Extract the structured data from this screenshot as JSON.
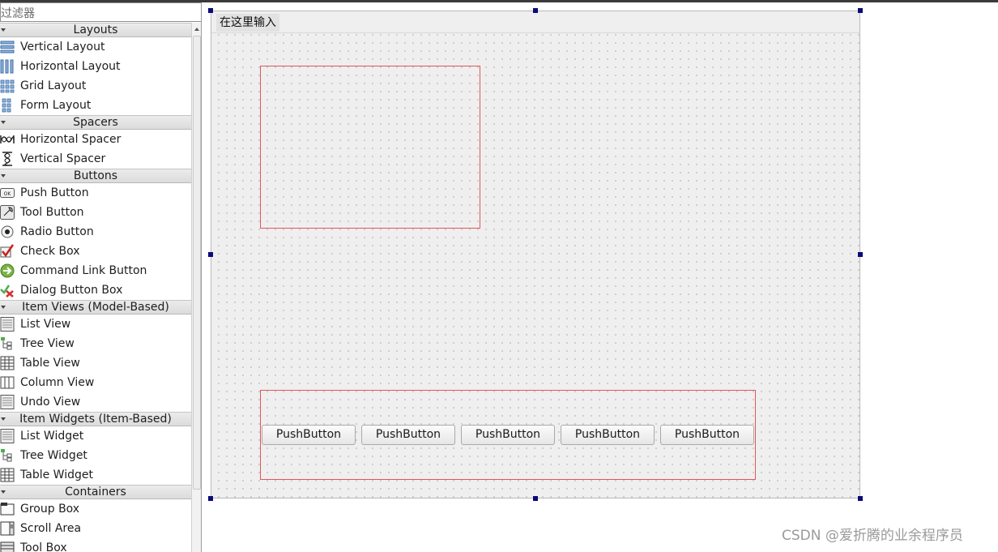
{
  "widget_box": {
    "filter_placeholder": "过滤器",
    "categories": [
      {
        "title": "Layouts",
        "items": [
          {
            "label": "Vertical Layout",
            "icon": "vertical-layout-icon"
          },
          {
            "label": "Horizontal Layout",
            "icon": "horizontal-layout-icon"
          },
          {
            "label": "Grid Layout",
            "icon": "grid-layout-icon"
          },
          {
            "label": "Form Layout",
            "icon": "form-layout-icon"
          }
        ]
      },
      {
        "title": "Spacers",
        "items": [
          {
            "label": "Horizontal Spacer",
            "icon": "horizontal-spacer-icon"
          },
          {
            "label": "Vertical Spacer",
            "icon": "vertical-spacer-icon"
          }
        ]
      },
      {
        "title": "Buttons",
        "items": [
          {
            "label": "Push Button",
            "icon": "push-button-icon"
          },
          {
            "label": "Tool Button",
            "icon": "tool-button-icon"
          },
          {
            "label": "Radio Button",
            "icon": "radio-button-icon"
          },
          {
            "label": "Check Box",
            "icon": "check-box-icon"
          },
          {
            "label": "Command Link Button",
            "icon": "command-link-icon"
          },
          {
            "label": "Dialog Button Box",
            "icon": "dialog-button-box-icon"
          }
        ]
      },
      {
        "title": "Item Views (Model-Based)",
        "items": [
          {
            "label": "List View",
            "icon": "list-view-icon"
          },
          {
            "label": "Tree View",
            "icon": "tree-view-icon"
          },
          {
            "label": "Table View",
            "icon": "table-view-icon"
          },
          {
            "label": "Column View",
            "icon": "column-view-icon"
          },
          {
            "label": "Undo View",
            "icon": "undo-view-icon"
          }
        ]
      },
      {
        "title": "Item Widgets (Item-Based)",
        "items": [
          {
            "label": "List Widget",
            "icon": "list-widget-icon"
          },
          {
            "label": "Tree Widget",
            "icon": "tree-widget-icon"
          },
          {
            "label": "Table Widget",
            "icon": "table-widget-icon"
          }
        ]
      },
      {
        "title": "Containers",
        "items": [
          {
            "label": "Group Box",
            "icon": "group-box-icon"
          },
          {
            "label": "Scroll Area",
            "icon": "scroll-area-icon"
          },
          {
            "label": "Tool Box",
            "icon": "tool-box-icon"
          }
        ]
      }
    ]
  },
  "form": {
    "menu_placeholder": "在这里输入",
    "push_buttons": [
      "PushButton",
      "PushButton",
      "PushButton",
      "PushButton",
      "PushButton"
    ]
  },
  "watermark": "CSDN @爱折腾的业余程序员",
  "colors": {
    "layout_outline": "#e0575b",
    "selection_handle": "#0a0a7a",
    "form_background": "#efefef",
    "category_header": "#e4e4e4"
  }
}
